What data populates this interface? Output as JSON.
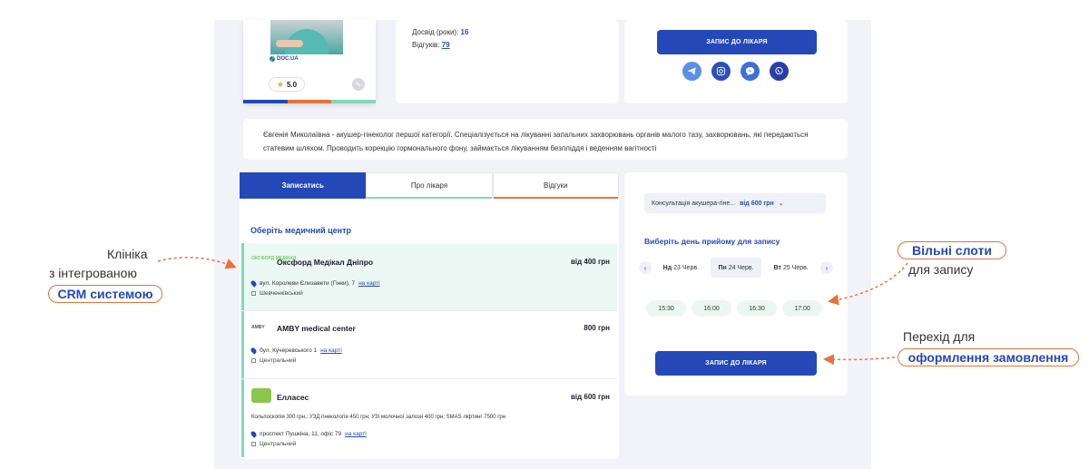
{
  "doctor": {
    "source_badge": "DOC.UA",
    "rating": "5.0",
    "experience_label": "Досвід (роки):",
    "experience_value": "16",
    "reviews_label": "Відгуків:",
    "reviews_value": "79"
  },
  "booking_top": {
    "button_label": "ЗАПИС ДО ЛІКАРЯ",
    "socials": [
      "telegram-icon",
      "instagram-icon",
      "messenger-icon",
      "viber-icon"
    ]
  },
  "description": "Євгенія Миколаївна - акушер-гінеколог першої категорії. Спеціалізується на лікуванні запальних захворювань органів малого тазу, захворювань, які передаються статевим шляхом. Проводить корекцію гормонального фону, займається лікуванням безпліддя і веденням вагітності",
  "tabs": [
    {
      "label": "Записатись",
      "active": true,
      "line_color": "#2448b8"
    },
    {
      "label": "Про лікаря",
      "active": false,
      "line_color": "#84d7bd"
    },
    {
      "label": "Відгуки",
      "active": false,
      "line_color": "#e8733a"
    }
  ],
  "clinics_title": "Оберіть медичний центр",
  "clinics": [
    {
      "logo": "ОКСФОРД МЕДІКАЛ",
      "name": "Оксфорд Медікал Дніпро",
      "price": "від 400 грн",
      "address": "вул. Королеви Єлизавети (Гінки), 7",
      "map_link": "на карті",
      "district": "Шевченківський"
    },
    {
      "logo": "AMBY",
      "name": "AMBY medical center",
      "price": "800 грн",
      "address": "бул. Кучеревського 1",
      "map_link": "на карті",
      "district": "Центральний"
    },
    {
      "logo": "",
      "name": "Елласес",
      "price": "від 600 грн",
      "services": "Кольпоскопія 300 грн.; УЗД гінекологія 450 грн; УЗІ молочної залози 400 грн; SMAS ліфтинг 7500 грн",
      "address": "проспект Пушкіна, 11, офіс 79",
      "map_link": "на карті",
      "district": "Центральний"
    }
  ],
  "slots": {
    "consultation": "Консультація акушера-гіне...",
    "consultation_price": "від 600 грн",
    "choose_day": "Виберіть день прийому для запису",
    "days": [
      {
        "weekday": "Нд",
        "date": "23 Черв.",
        "active": false
      },
      {
        "weekday": "Пн",
        "date": "24 Черв.",
        "active": true
      },
      {
        "weekday": "Вт",
        "date": "25 Черв.",
        "active": false
      }
    ],
    "times": [
      "15:30",
      "16:00",
      "16:30",
      "17:00"
    ],
    "button_label": "ЗАПИС ДО ЛІКАРЯ"
  },
  "annotations": {
    "clinic_line1": "Клініка",
    "clinic_line2": "з інтегрованою",
    "clinic_pill": "CRM системою",
    "slots_pill": "Вільні  слоти",
    "slots_line": "для запису",
    "order_line": "Перехід для",
    "order_pill": "оформлення замовлення"
  },
  "colors": {
    "brand_blue": "#2448b8",
    "accent_orange": "#e8733a",
    "accent_mint": "#84d7bd"
  }
}
